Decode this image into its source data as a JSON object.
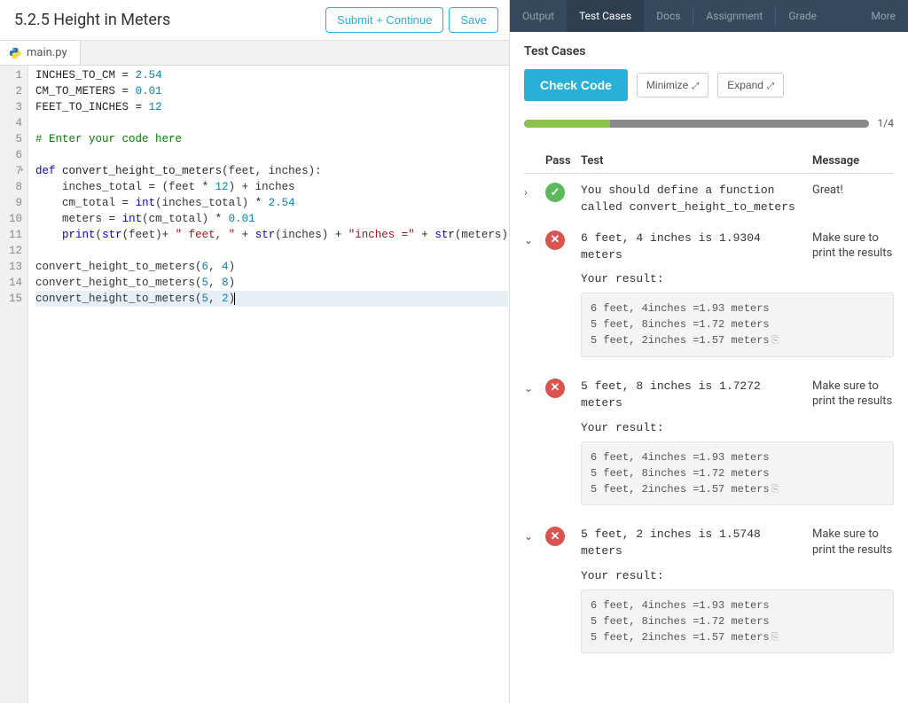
{
  "header": {
    "title": "5.2.5 Height in Meters",
    "submit_continue": "Submit + Continue",
    "save": "Save"
  },
  "file_tab": {
    "name": "main.py"
  },
  "code_lines": [
    {
      "n": 1,
      "html": "<span class='tok-var'>INCHES_TO_CM</span> <span class='tok-op'>=</span> <span class='tok-num'>2.54</span>"
    },
    {
      "n": 2,
      "html": "<span class='tok-var'>CM_TO_METERS</span> <span class='tok-op'>=</span> <span class='tok-num'>0.01</span>"
    },
    {
      "n": 3,
      "html": "<span class='tok-var'>FEET_TO_INCHES</span> <span class='tok-op'>=</span> <span class='tok-num'>12</span>"
    },
    {
      "n": 4,
      "html": ""
    },
    {
      "n": 5,
      "html": "<span class='tok-comment'># Enter your code here</span>"
    },
    {
      "n": 6,
      "html": ""
    },
    {
      "n": 7,
      "fold": true,
      "html": "<span class='tok-kw'>def</span> <span class='tok-fn'>convert_height_to_meters</span>(feet, inches):"
    },
    {
      "n": 8,
      "html": "    inches_total <span class='tok-op'>=</span> (feet <span class='tok-op'>*</span> <span class='tok-num'>12</span>) <span class='tok-op'>+</span> inches"
    },
    {
      "n": 9,
      "html": "    cm_total <span class='tok-op'>=</span> <span class='tok-builtin'>int</span>(inches_total) <span class='tok-op'>*</span> <span class='tok-num'>2.54</span>"
    },
    {
      "n": 10,
      "html": "    meters <span class='tok-op'>=</span> <span class='tok-builtin'>int</span>(cm_total) <span class='tok-op'>*</span> <span class='tok-num'>0.01</span>"
    },
    {
      "n": 11,
      "html": "    <span class='tok-builtin'>print</span>(<span class='tok-builtin'>str</span>(feet)<span class='tok-op'>+</span> <span class='tok-str'>\" feet, \"</span> <span class='tok-op'>+</span> <span class='tok-builtin'>str</span>(inches) <span class='tok-op'>+</span> <span class='tok-str'>\"inches =\"</span> <span class='tok-op'>+</span> <span class='tok-builtin'>str</span>(meters)"
    },
    {
      "n": 12,
      "html": ""
    },
    {
      "n": 13,
      "html": "convert_height_to_meters(<span class='tok-num'>6</span>, <span class='tok-num'>4</span>)"
    },
    {
      "n": 14,
      "html": "convert_height_to_meters(<span class='tok-num'>5</span>, <span class='tok-num'>8</span>)"
    },
    {
      "n": 15,
      "hl": true,
      "html": "convert_height_to_meters(<span class='tok-num'>5</span>, <span class='tok-num'>2</span>)<span class='cursor-blink'></span>"
    }
  ],
  "nav": {
    "output": "Output",
    "test_cases": "Test Cases",
    "docs": "Docs",
    "assignment": "Assignment",
    "grade": "Grade",
    "more": "More"
  },
  "test_panel": {
    "title": "Test Cases",
    "check_code": "Check Code",
    "minimize": "Minimize",
    "expand": "Expand",
    "progress": "1/4",
    "headers": {
      "pass": "Pass",
      "test": "Test",
      "message": "Message"
    },
    "your_result": "Your result:",
    "result_text": "6 feet, 4inches =1.93 meters\n5 feet, 8inches =1.72 meters\n5 feet, 2inches =1.57 meters",
    "tests": [
      {
        "expand": ">",
        "pass": true,
        "test": "You should define a function called convert_height_to_meters",
        "message": "Great!",
        "show_result": false
      },
      {
        "expand": "v",
        "pass": false,
        "test": "6 feet, 4 inches is 1.9304 meters",
        "message": "Make sure to print the results",
        "show_result": true
      },
      {
        "expand": "v",
        "pass": false,
        "test": "5 feet, 8 inches is 1.7272 meters",
        "message": "Make sure to print the results",
        "show_result": true
      },
      {
        "expand": "v",
        "pass": false,
        "test": "5 feet, 2 inches is 1.5748 meters",
        "message": "Make sure to print the results",
        "show_result": true
      }
    ]
  }
}
